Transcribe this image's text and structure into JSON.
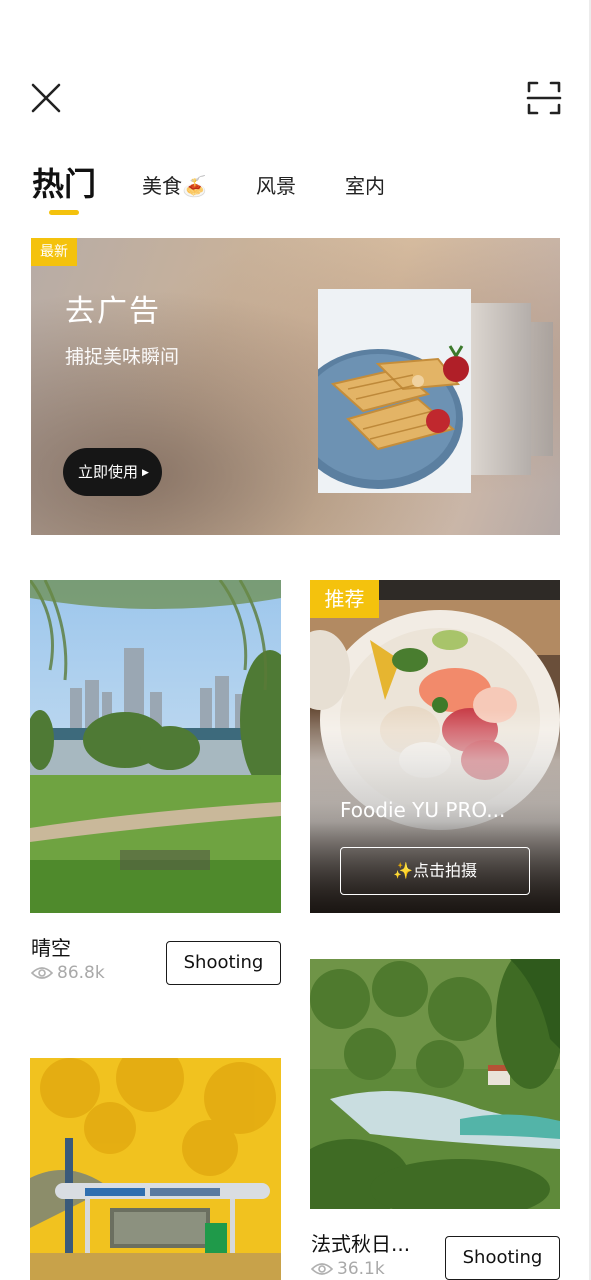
{
  "header": {
    "close_icon": "close-icon",
    "scan_icon": "scan-frame-icon"
  },
  "tabs": [
    {
      "label": "热门",
      "active": true
    },
    {
      "label": "美食🍝",
      "active": false
    },
    {
      "label": "风景",
      "active": false
    },
    {
      "label": "室内",
      "active": false
    }
  ],
  "banner": {
    "badge": "最新",
    "title": "去广告",
    "subtitle": "捕捉美味瞬间",
    "button": "立即使用"
  },
  "cards": [
    {
      "id": "park",
      "caption": "晴空",
      "views": "86.8k",
      "button": "Shooting"
    },
    {
      "id": "food",
      "badge": "推荐",
      "title": "Foodie YU PRO...",
      "button": "✨点击拍摄"
    },
    {
      "id": "river",
      "caption": "法式秋日...",
      "views": "36.1k",
      "button": "Shooting"
    },
    {
      "id": "ginkgo"
    }
  ],
  "colors": {
    "accent": "#f4c20d",
    "text": "#111111",
    "muted": "#a9a9a9"
  }
}
